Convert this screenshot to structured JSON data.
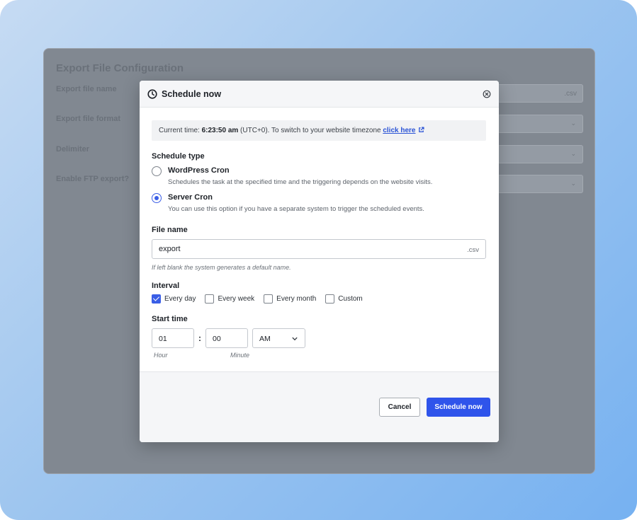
{
  "background": {
    "title": "Export File Configuration",
    "fields": [
      {
        "label": "Export file name",
        "suffix": ".csv"
      },
      {
        "label": "Export file format",
        "suffix": ""
      },
      {
        "label": "Delimiter",
        "suffix": ""
      },
      {
        "label": "Enable FTP export?",
        "suffix": ""
      }
    ]
  },
  "modal": {
    "title": "Schedule now",
    "current_time": {
      "prefix": "Current time: ",
      "time": "6:23:50 am",
      "middle": " (UTC+0). To switch to your website timezone ",
      "link": "click here"
    },
    "schedule_type": {
      "title": "Schedule type",
      "options": [
        {
          "label": "WordPress Cron",
          "desc": "Schedules the task at the specified time and the triggering depends on the website visits.",
          "selected": false
        },
        {
          "label": "Server Cron",
          "desc": "You can use this option if you have a separate system to trigger the scheduled events.",
          "selected": true
        }
      ]
    },
    "file_name": {
      "title": "File name",
      "value": "export",
      "suffix": ".csv",
      "hint": "If left blank the system generates a default name."
    },
    "interval": {
      "title": "Interval",
      "options": [
        {
          "label": "Every day",
          "checked": true
        },
        {
          "label": "Every week",
          "checked": false
        },
        {
          "label": "Every month",
          "checked": false
        },
        {
          "label": "Custom",
          "checked": false
        }
      ]
    },
    "start_time": {
      "title": "Start time",
      "hour": "01",
      "minute": "00",
      "meridiem": "AM",
      "hour_label": "Hour",
      "minute_label": "Minute"
    },
    "buttons": {
      "cancel": "Cancel",
      "submit": "Schedule now"
    }
  },
  "colors": {
    "accent": "#2f54eb",
    "link": "#2b54d6"
  }
}
